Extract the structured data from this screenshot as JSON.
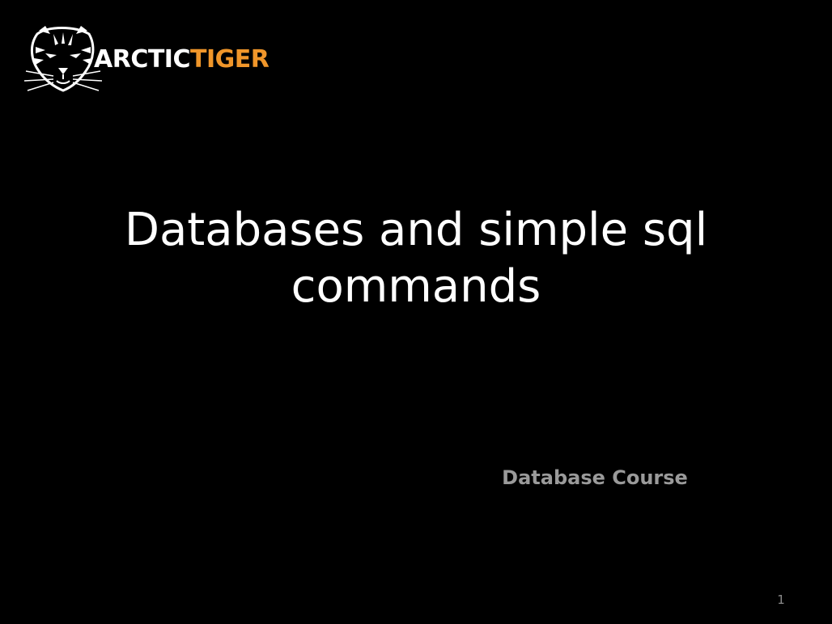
{
  "logo": {
    "icon": "tiger-head-icon",
    "word_part1": "ARCTIC",
    "word_part2": "TIGER",
    "colors": {
      "part1": "#ffffff",
      "part2": "#f0962a"
    }
  },
  "slide": {
    "title": "Databases and simple sql commands",
    "subtitle": "Database Course",
    "page_number": "1",
    "colors": {
      "background": "#000000",
      "title": "#ffffff",
      "subtitle": "#9a9a9a"
    }
  }
}
